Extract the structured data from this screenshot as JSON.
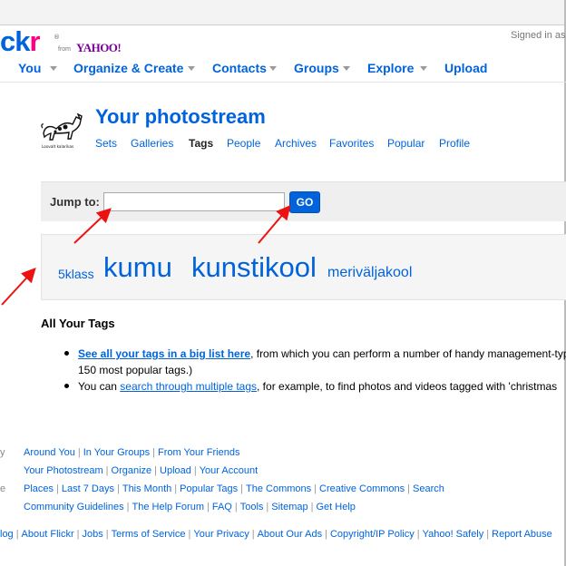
{
  "brand": {
    "logo_part1": "ck",
    "logo_part2": "r",
    "reg": "®",
    "from": "from",
    "yahoo": "YAHOO!",
    "accent": "#0063dc",
    "pink": "#ff0084"
  },
  "signed_in": "Signed in as",
  "nav": [
    "You",
    "Organize & Create",
    "Contacts",
    "Groups",
    "Explore",
    "Upload"
  ],
  "page": {
    "title": "Your photostream",
    "buddy_caption": "Loovalt kalarikas",
    "subnav": [
      "Sets",
      "Galleries",
      "Tags",
      "People",
      "Archives",
      "Favorites",
      "Popular",
      "Profile"
    ],
    "current_subnav": "Tags"
  },
  "jump": {
    "label": "Jump to:",
    "value": "",
    "placeholder": "",
    "go_label": "GO"
  },
  "tags": [
    {
      "name": "5klass",
      "size": "small"
    },
    {
      "name": "kumu",
      "size": "huge"
    },
    {
      "name": "kunstikool",
      "size": "huge"
    },
    {
      "name": "meriväljakool",
      "size": "medium"
    }
  ],
  "all_tags": {
    "heading": "All Your Tags",
    "bullet1_link": "See all your tags in a big list here",
    "bullet1_text": ", from which you can perform a number of handy management-typ",
    "bullet1_text2": "150 most popular tags.)",
    "bullet2_pre": "You can ",
    "bullet2_link": "search through multiple tags",
    "bullet2_post": ", for example, to find photos and videos tagged with 'christmas"
  },
  "footer": {
    "row1_cat": "y",
    "row1": [
      "Around You",
      "In Your Groups",
      "From Your Friends"
    ],
    "row2": [
      "Your Photostream",
      "Organize",
      "Upload",
      "Your Account"
    ],
    "row3_cat": "e",
    "row3": [
      "Places",
      "Last 7 Days",
      "This Month",
      "Popular Tags",
      "The Commons",
      "Creative Commons",
      "Search"
    ],
    "row4": [
      "Community Guidelines",
      "The Help Forum",
      "FAQ",
      "Tools",
      "Sitemap",
      "Get Help"
    ],
    "row5": [
      "log",
      "About Flickr",
      "Jobs",
      "Terms of Service",
      "Your Privacy",
      "About Our Ads",
      "Copyright/IP Policy",
      "Yahoo! Safely",
      "Report Abuse"
    ]
  },
  "annotation_color": "#ee1111"
}
